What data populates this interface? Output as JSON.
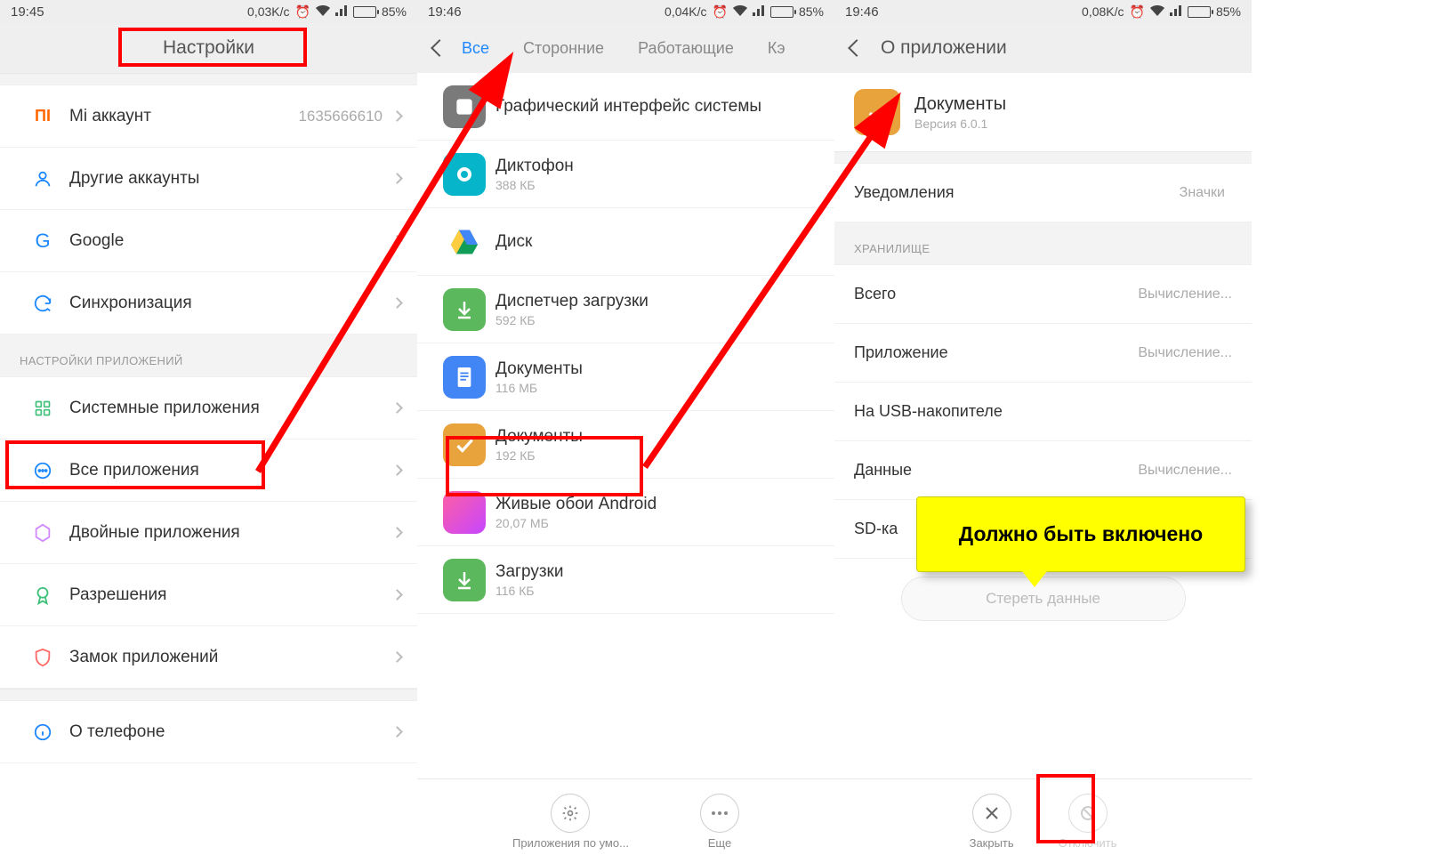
{
  "screen1": {
    "status": {
      "time": "19:45",
      "speed": "0,03K/c",
      "battery": "85%"
    },
    "title": "Настройки",
    "rows": {
      "mi": {
        "label": "Mi аккаунт",
        "value": "1635666610"
      },
      "other": {
        "label": "Другие аккаунты"
      },
      "google": {
        "label": "Google"
      },
      "sync": {
        "label": "Синхронизация"
      }
    },
    "section": "НАСТРОЙКИ ПРИЛОЖЕНИЙ",
    "rows2": {
      "sys": {
        "label": "Системные приложения"
      },
      "all": {
        "label": "Все приложения"
      },
      "dual": {
        "label": "Двойные приложения"
      },
      "perm": {
        "label": "Разрешения"
      },
      "lock": {
        "label": "Замок приложений"
      },
      "about": {
        "label": "О телефоне"
      }
    }
  },
  "screen2": {
    "status": {
      "time": "19:46",
      "speed": "0,04K/c",
      "battery": "85%"
    },
    "tabs": {
      "t1": "Все",
      "t2": "Сторонние",
      "t3": "Работающие",
      "t4": "Кэ"
    },
    "apps": {
      "sysui": {
        "name": "Графический интерфейс системы",
        "sub": ""
      },
      "rec": {
        "name": "Диктофон",
        "sub": "388 КБ"
      },
      "drive": {
        "name": "Диск",
        "sub": ""
      },
      "dm": {
        "name": "Диспетчер загрузки",
        "sub": "592 КБ"
      },
      "docs1": {
        "name": "Документы",
        "sub": "116 МБ"
      },
      "docs2": {
        "name": "Документы",
        "sub": "192 КБ"
      },
      "lwp": {
        "name": "Живые обои Android",
        "sub": "20,07 МБ"
      },
      "dl": {
        "name": "Загрузки",
        "sub": "116 КБ"
      }
    },
    "bottom": {
      "b1": "Приложения по умо...",
      "b2": "Еще"
    }
  },
  "screen3": {
    "status": {
      "time": "19:46",
      "speed": "0,08K/c",
      "battery": "85%"
    },
    "title": "О приложении",
    "app": {
      "name": "Документы",
      "ver": "Версия 6.0.1"
    },
    "notif": {
      "label": "Уведомления",
      "value": "Значки"
    },
    "section": "ХРАНИЛИЩЕ",
    "storage": {
      "total": {
        "label": "Всего",
        "value": "Вычисление..."
      },
      "app": {
        "label": "Приложение",
        "value": "Вычисление..."
      },
      "usb": {
        "label": "На USB-накопителе",
        "value": ""
      },
      "data": {
        "label": "Данные",
        "value": "Вычисление..."
      },
      "sd": {
        "label": "SD-ка",
        "value": ""
      }
    },
    "erase": "Стереть данные",
    "bottom": {
      "b1": "Закрыть",
      "b2": "Отключить"
    }
  },
  "callout": "Должно быть включено"
}
